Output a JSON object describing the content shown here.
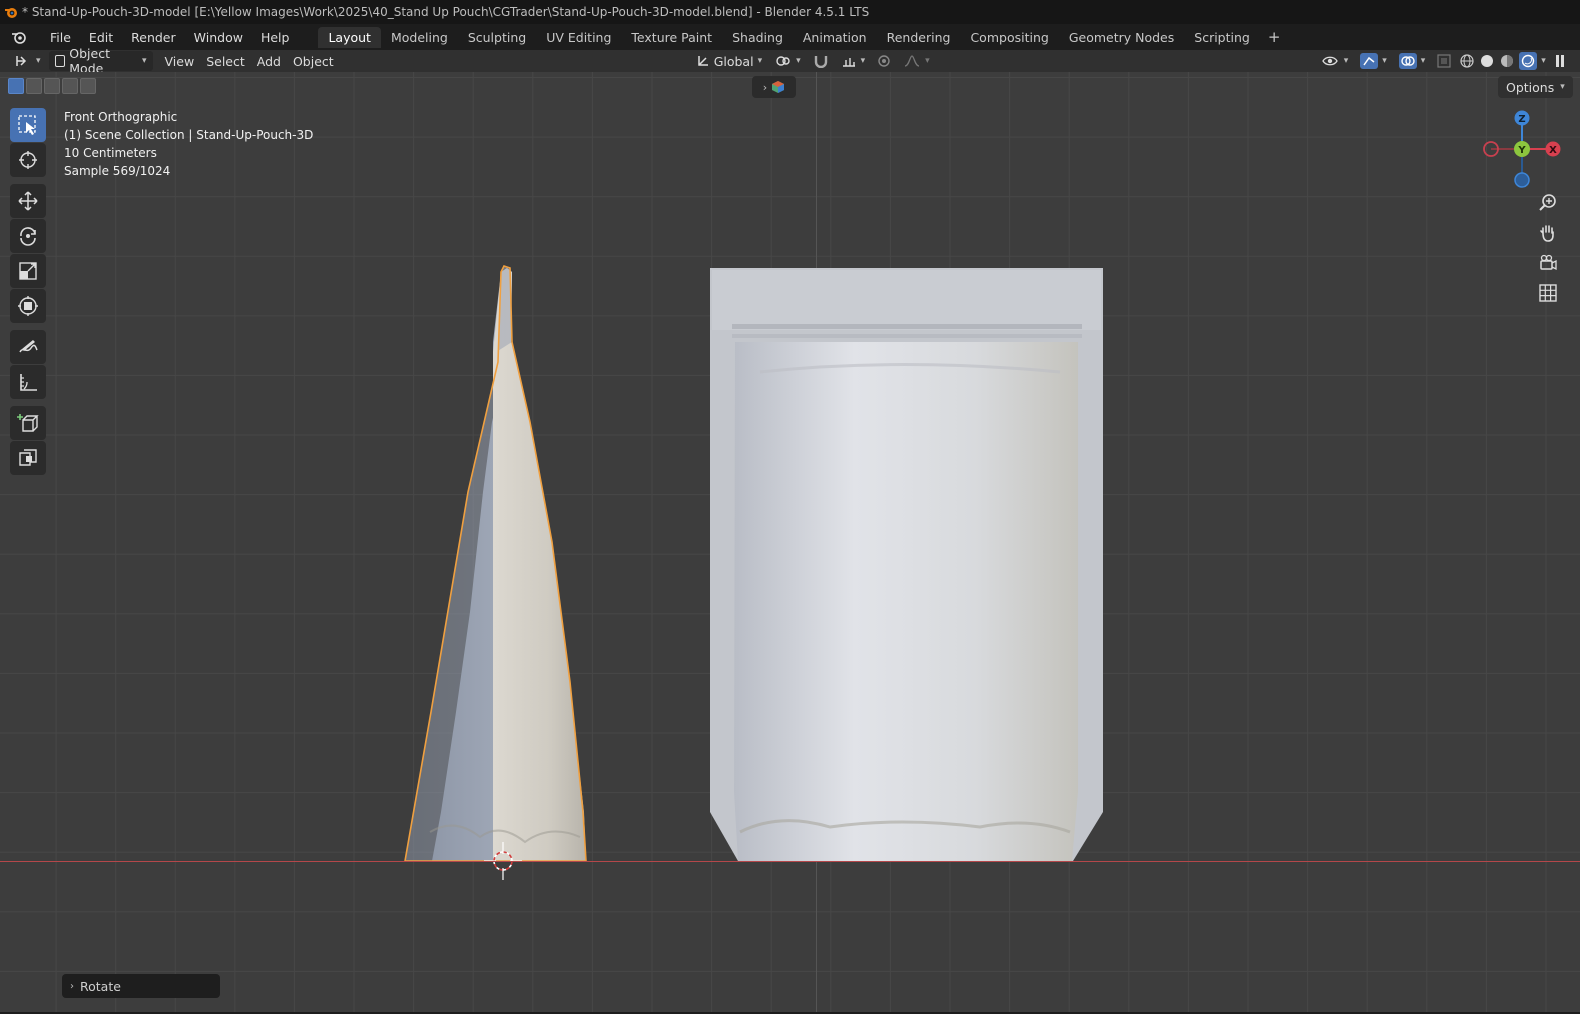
{
  "window": {
    "title": "* Stand-Up-Pouch-3D-model [E:\\Yellow Images\\Work\\2025\\40_Stand Up Pouch\\CGTrader\\Stand-Up-Pouch-3D-model.blend] - Blender 4.5.1 LTS"
  },
  "menu": {
    "items": [
      "File",
      "Edit",
      "Render",
      "Window",
      "Help"
    ]
  },
  "workspaces": {
    "tabs": [
      "Layout",
      "Modeling",
      "Sculpting",
      "UV Editing",
      "Texture Paint",
      "Shading",
      "Animation",
      "Rendering",
      "Compositing",
      "Geometry Nodes",
      "Scripting"
    ],
    "active": "Layout",
    "add_icon": "plus-icon"
  },
  "header": {
    "mode": "Object Mode",
    "menus": [
      "View",
      "Select",
      "Add",
      "Object"
    ],
    "transform_orientation": "Global"
  },
  "viewport": {
    "view_name": "Front Orthographic",
    "collection": "(1) Scene Collection | Stand-Up-Pouch-3D",
    "scale": "10 Centimeters",
    "sample": "Sample 569/1024",
    "options_label": "Options",
    "gizmo_axes": {
      "z": "Z",
      "y": "Y",
      "x": "X"
    },
    "colors": {
      "selection_outline": "#f0a040",
      "x_axis": "#b4474a",
      "active_tool": "#4772b3"
    }
  },
  "toolbar": {
    "tools": [
      "select-box-icon",
      "cursor-icon",
      "move-icon",
      "rotate-icon",
      "scale-icon",
      "transform-icon",
      "annotate-icon",
      "measure-icon",
      "add-cube-icon",
      "scale-cage-icon"
    ]
  },
  "operator_panel": {
    "label": "Rotate"
  }
}
